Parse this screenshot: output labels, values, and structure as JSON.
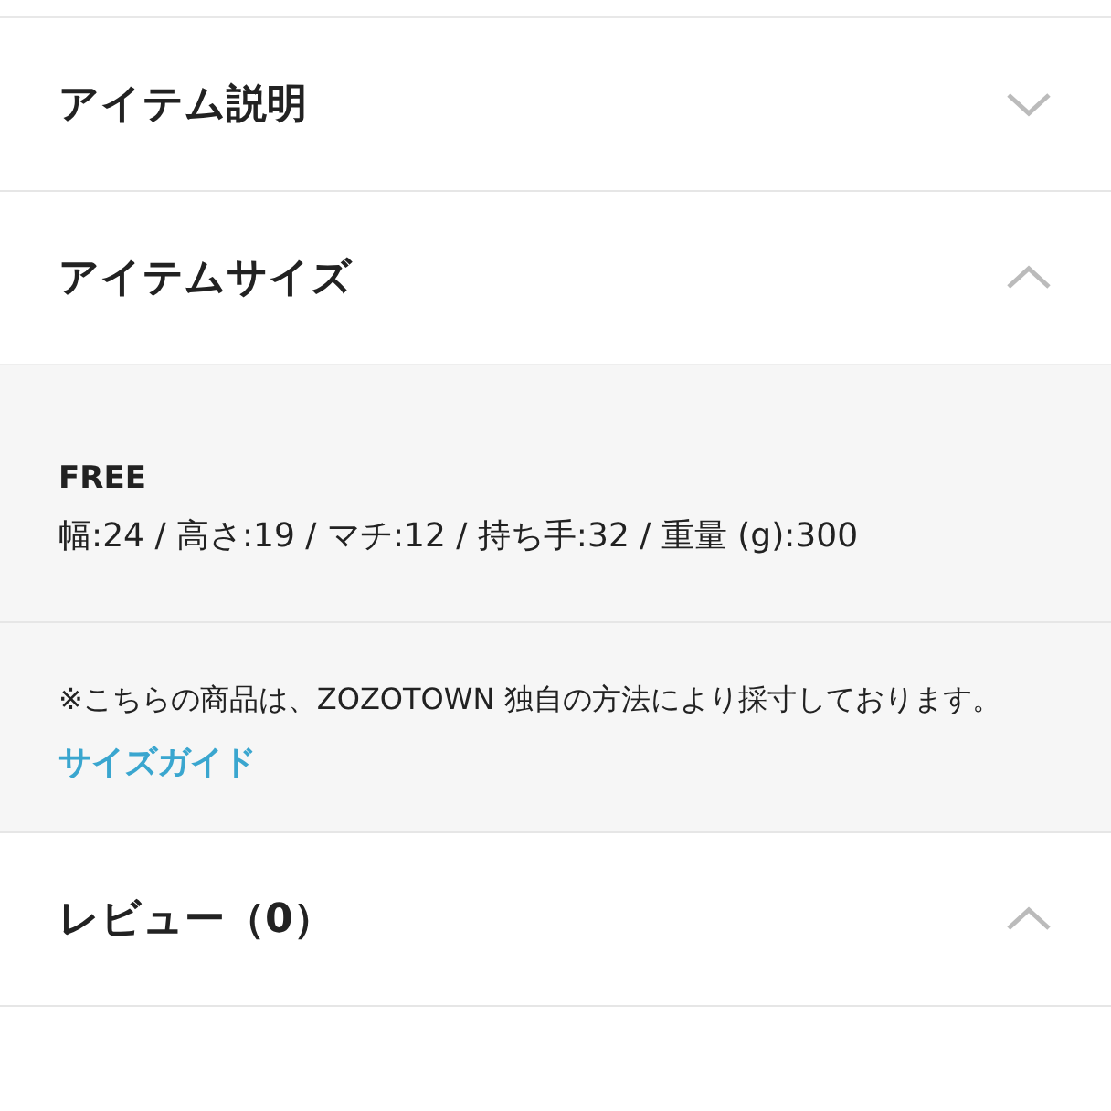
{
  "sections": [
    {
      "title": "アイテム説明",
      "expanded": false
    },
    {
      "title": "アイテムサイズ",
      "expanded": true,
      "size_name": "FREE",
      "measurements": "幅:24 / 高さ:19 / マチ:12 / 持ち手:32 / 重量 (g):300",
      "note": "※こちらの商品は、ZOZOTOWN 独自の方法により採寸しております。",
      "link": "サイズガイド"
    },
    {
      "title": "レビュー（0）",
      "expanded": true
    }
  ]
}
